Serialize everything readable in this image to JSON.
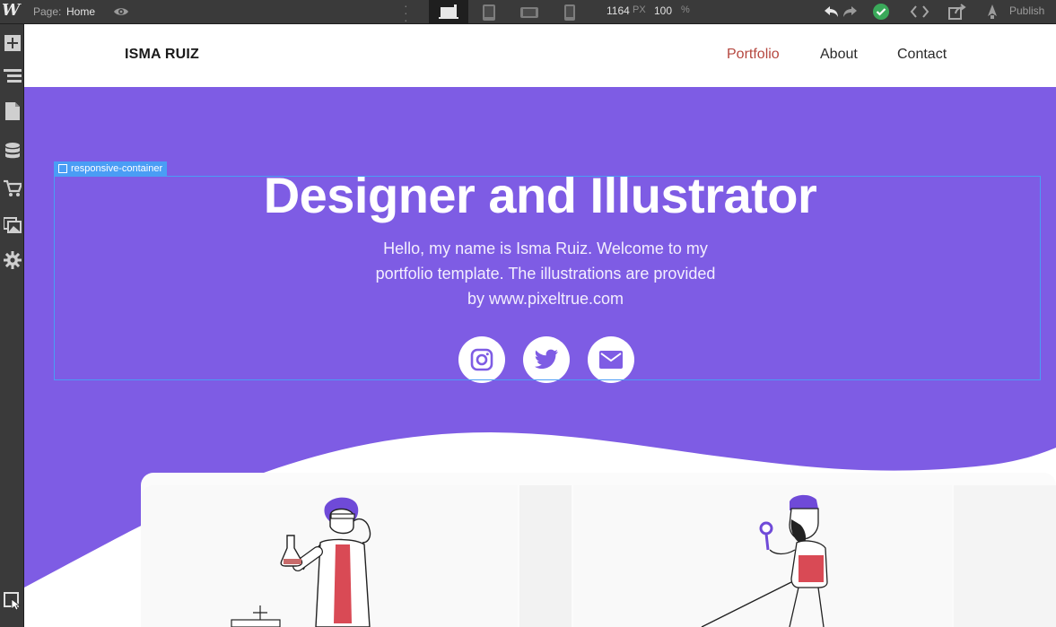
{
  "toolbar": {
    "logo": "W",
    "page_label": "Page:",
    "page_name": "Home",
    "width_value": "1164",
    "width_unit": "PX",
    "zoom_value": "100",
    "zoom_unit": "%",
    "publish_label": "Publish",
    "breakpoints": [
      "desktop-icon",
      "tablet-icon",
      "mobile-landscape-icon",
      "mobile-portrait-icon"
    ],
    "status_color": "#3aa95a"
  },
  "left_panel": {
    "icons": [
      "add-panel-icon",
      "navigator-icon",
      "pages-icon",
      "cms-icon",
      "ecommerce-icon",
      "assets-icon",
      "settings-icon",
      "select-tool-icon"
    ]
  },
  "site": {
    "brand": "ISMA RUIZ",
    "nav": [
      "Portfolio",
      "About",
      "Contact"
    ],
    "hero_title": "Designer and Illustrator",
    "hero_line1": "Hello, my name is Isma Ruiz. Welcome to my",
    "hero_line2": "portfolio template. The illustrations are provided",
    "hero_line3": "by www.pixeltrue.com",
    "social": [
      "instagram-icon",
      "twitter-icon",
      "mail-icon"
    ],
    "hero_color": "#7e5ce4",
    "link_active_color": "#b5473f"
  },
  "selection": {
    "label": "responsive-container",
    "color": "#4a9df5"
  }
}
